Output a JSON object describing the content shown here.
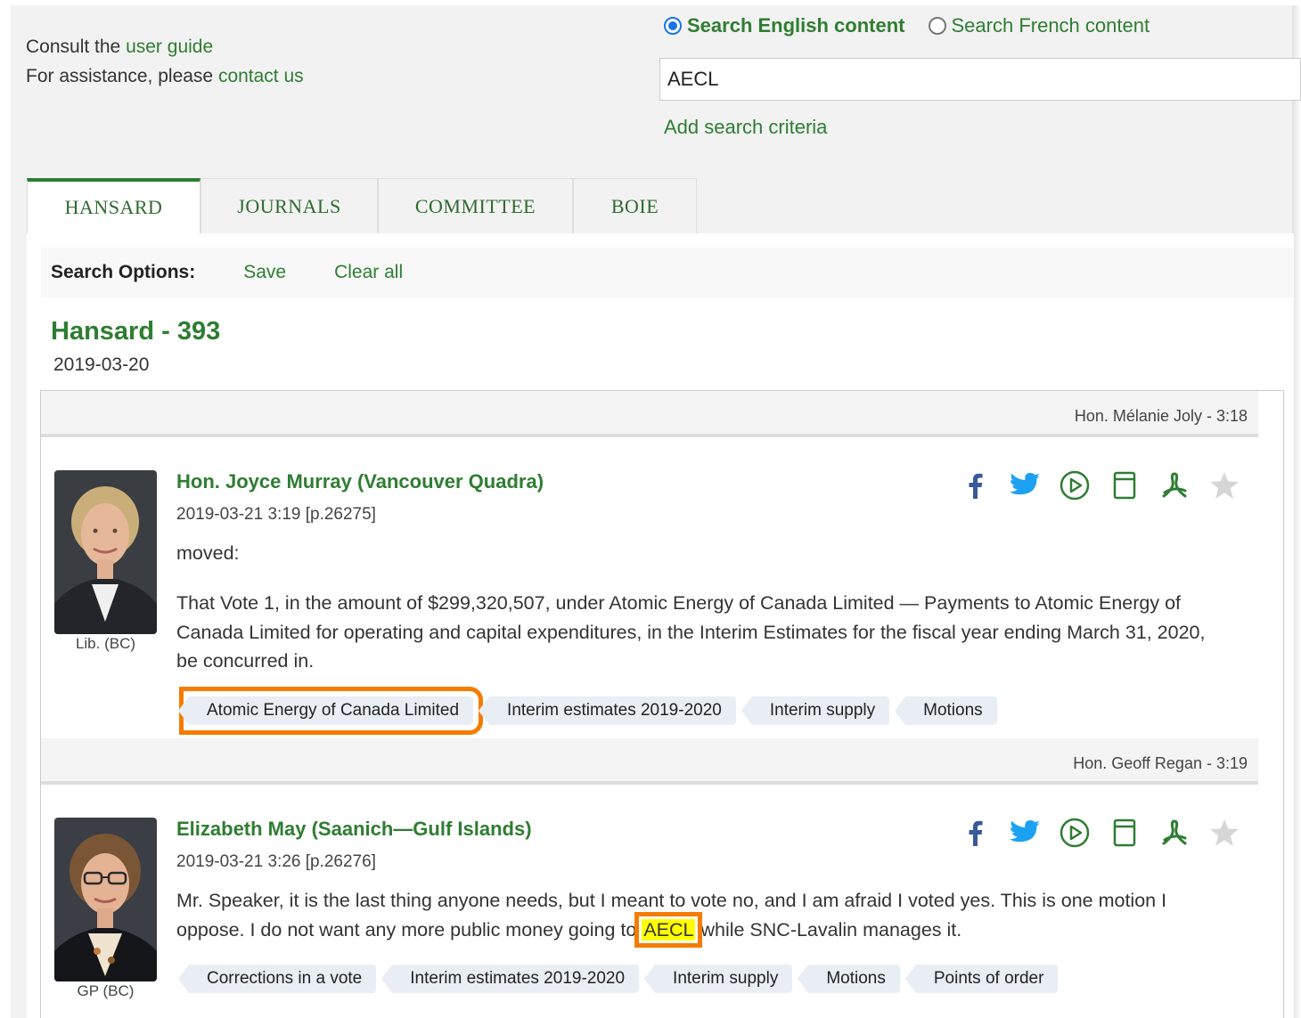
{
  "help": {
    "line1_prefix": "Consult the ",
    "line1_link": "user guide",
    "line2_prefix": "For assistance, please ",
    "line2_link": "contact us"
  },
  "language": {
    "english_label": "Search English content",
    "french_label": "Search French content",
    "selected": "english"
  },
  "search": {
    "value": "AECL",
    "add_criteria": "Add search criteria"
  },
  "tabs": [
    {
      "label": "HANSARD",
      "active": true
    },
    {
      "label": "JOURNALS",
      "active": false
    },
    {
      "label": "COMMITTEE",
      "active": false
    },
    {
      "label": "BOIE",
      "active": false
    }
  ],
  "options": {
    "title": "Search Options:",
    "save": "Save",
    "clear": "Clear all"
  },
  "hansard": {
    "title": "Hansard - 393",
    "date": "2019-03-20"
  },
  "results": [
    {
      "previous_speaker": "Hon. Mélanie Joly - 3:18",
      "speaker": "Hon. Joyce Murray (Vancouver Quadra)",
      "meta": "2019-03-21 3:19 [p.26275]",
      "affiliation": "Lib. (BC)",
      "intro": "moved:",
      "text": "That Vote 1, in the amount of $299,320,507, under Atomic Energy of Canada Limited — Payments to Atomic Energy of Canada Limited for operating and capital expenditures, in the Interim Estimates for the fiscal year ending March 31, 2020, be concurred in.",
      "tags": [
        "Atomic Energy of Canada Limited",
        "Interim estimates 2019-2020",
        "Interim supply",
        "Motions"
      ]
    },
    {
      "previous_speaker": "Hon. Geoff Regan - 3:19",
      "speaker": "Elizabeth May (Saanich—Gulf Islands)",
      "meta": "2019-03-21 3:26 [p.26276]",
      "affiliation": "GP (BC)",
      "text_before": "Mr. Speaker, it is the last thing anyone needs, but I meant to vote no, and I am afraid I voted yes. This is one motion I oppose. I do not want any more public money going to ",
      "highlight": "AECL",
      "text_after": " while SNC-Lavalin manages it.",
      "tags": [
        "Corrections in a vote",
        "Interim estimates 2019-2020",
        "Interim supply",
        "Motions",
        "Points of order"
      ]
    }
  ],
  "icons": [
    "facebook-icon",
    "twitter-icon",
    "play-icon",
    "bookmark-icon",
    "pdf-icon",
    "star-icon"
  ],
  "colors": {
    "accent_green": "#2e7d32",
    "highlight_yellow": "#ffff00",
    "annotation_orange": "#f57c00",
    "facebook_blue": "#3b5998",
    "twitter_blue": "#1da1f2"
  }
}
